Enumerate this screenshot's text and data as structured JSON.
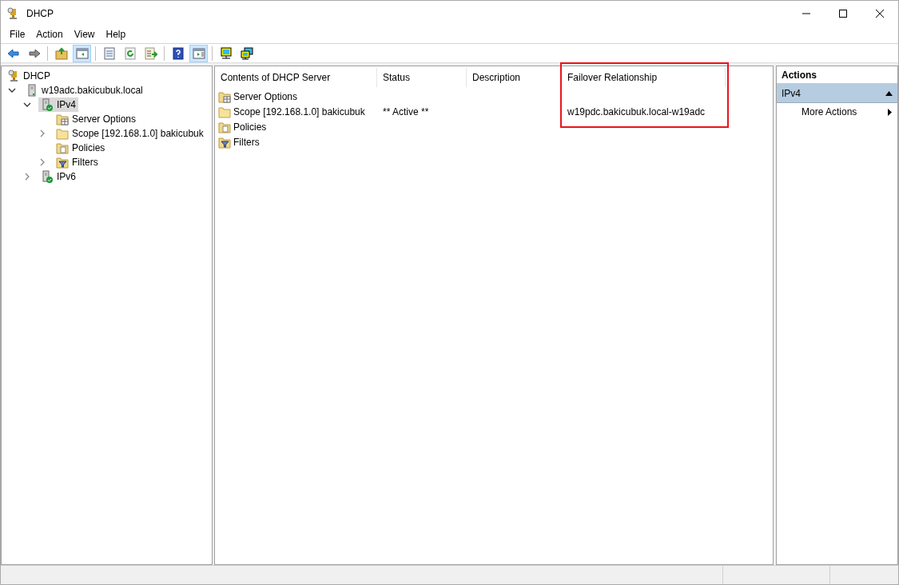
{
  "window": {
    "title": "DHCP"
  },
  "menu": [
    "File",
    "Action",
    "View",
    "Help"
  ],
  "toolbar": [
    [
      {
        "kind": "back",
        "pressed": false
      },
      {
        "kind": "forward",
        "pressed": false
      }
    ],
    [
      {
        "kind": "up",
        "pressed": false
      },
      {
        "kind": "tree",
        "pressed": true
      }
    ],
    [
      {
        "kind": "props",
        "pressed": false
      },
      {
        "kind": "refresh",
        "pressed": false
      },
      {
        "kind": "export",
        "pressed": false
      }
    ],
    [
      {
        "kind": "help",
        "pressed": false
      },
      {
        "kind": "pane",
        "pressed": true
      }
    ],
    [
      {
        "kind": "monitor",
        "pressed": false
      },
      {
        "kind": "monitors",
        "pressed": false
      }
    ]
  ],
  "tree": [
    {
      "label": "DHCP",
      "kind": "dhcp",
      "selected": false,
      "children": [
        {
          "label": "w19adc.bakicubuk.local",
          "kind": "server",
          "expanded": true,
          "selected": false,
          "children": [
            {
              "label": "IPv4",
              "kind": "ip",
              "expanded": true,
              "selected": true,
              "children": [
                {
                  "label": "Server Options",
                  "kind": "options",
                  "selected": false
                },
                {
                  "label": "Scope [192.168.1.0] bakicubuk",
                  "kind": "folder",
                  "expanded": false,
                  "selected": false
                },
                {
                  "label": "Policies",
                  "kind": "policies",
                  "selected": false
                },
                {
                  "label": "Filters",
                  "kind": "filters",
                  "expanded": false,
                  "selected": false
                }
              ]
            },
            {
              "label": "IPv6",
              "kind": "ip",
              "expanded": false,
              "selected": false
            }
          ]
        }
      ]
    }
  ],
  "list": {
    "columns": [
      "Contents of DHCP Server",
      "Status",
      "Description",
      "Failover Relationship"
    ],
    "rows": [
      {
        "kind": "options",
        "name": "Server Options"
      },
      {
        "kind": "folder",
        "name": "Scope [192.168.1.0] bakicubuk",
        "status": "** Active **",
        "failover_relationship": "w19pdc.bakicubuk.local-w19adc"
      },
      {
        "kind": "policies",
        "name": "Policies"
      },
      {
        "kind": "filters",
        "name": "Filters"
      }
    ]
  },
  "actions": {
    "title": "Actions",
    "section": "IPv4",
    "items": [
      "More Actions"
    ]
  }
}
